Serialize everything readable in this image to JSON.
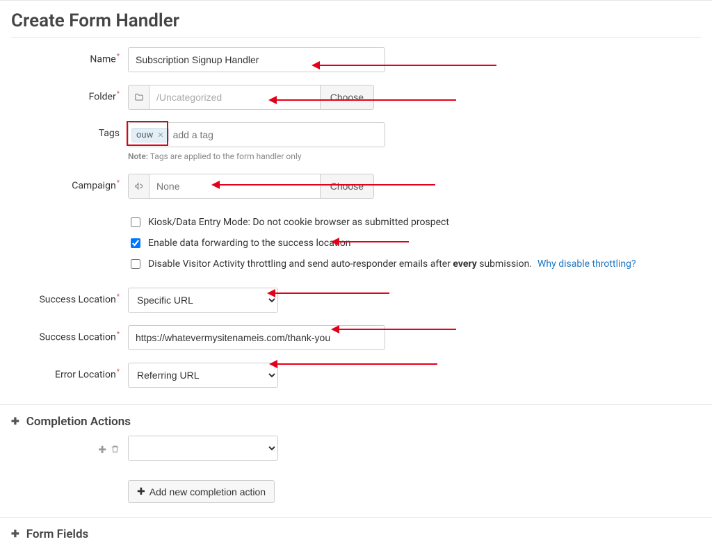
{
  "title": "Create Form Handler",
  "labels": {
    "name": "Name",
    "folder": "Folder",
    "tags": "Tags",
    "campaign": "Campaign",
    "success_location_type": "Success Location",
    "success_location_url": "Success Location",
    "error_location": "Error Location"
  },
  "fields": {
    "name_value": "Subscription Signup Handler",
    "folder_value": "/Uncategorized",
    "folder_choose": "Choose",
    "tag_value": "ouw",
    "tag_placeholder": "add a tag",
    "tags_note_prefix": "Note:",
    "tags_note_text": " Tags are applied to the form handler only",
    "campaign_placeholder": "None",
    "campaign_choose": "Choose",
    "success_type_value": "Specific URL",
    "success_url_value": "https://whatevermysitenameis.com/thank-you",
    "error_location_value": "Referring URL"
  },
  "checkboxes": {
    "kiosk_label": "Kiosk/Data Entry Mode: Do not cookie browser as submitted prospect",
    "kiosk_checked": false,
    "forward_label": "Enable data forwarding to the success location",
    "forward_checked": true,
    "throttle_label_pre": "Disable Visitor Activity throttling and send auto-responder emails after ",
    "throttle_label_bold": "every",
    "throttle_label_post": " submission. ",
    "throttle_checked": false,
    "throttle_link": "Why disable throttling?"
  },
  "sections": {
    "completion_title": "Completion Actions",
    "add_completion_label": "Add new completion action",
    "form_fields_title": "Form Fields"
  },
  "icons": {
    "folder": "folder-icon",
    "megaphone": "megaphone-icon",
    "plus": "plus-icon",
    "trash": "trash-icon"
  }
}
